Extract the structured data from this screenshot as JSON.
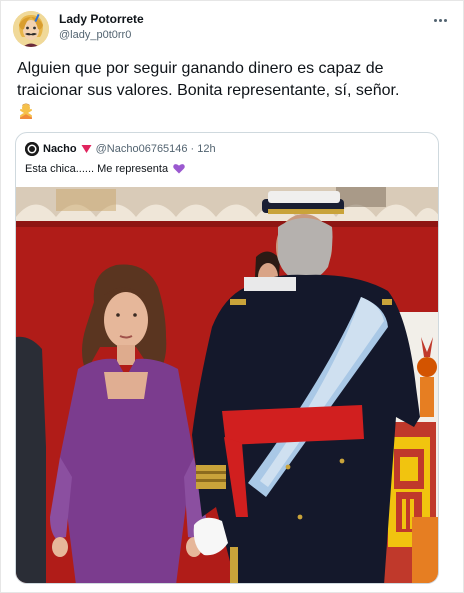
{
  "tweet": {
    "author_name": "Lady Potorrete",
    "author_handle": "@lady_p0t0rr0",
    "text": "Alguien que por seguir ganando dinero es capaz de traicionar sus valores. Bonita representante, sí, señor.",
    "trailing_emoji": "person-gesturing-no-emoji",
    "more_icon": "more-horizontal-icon"
  },
  "quote": {
    "author_name": "Nacho",
    "badge_icon": "heart-icon",
    "badge_color": "#e0245e",
    "author_handle": "@Nacho06765146",
    "separator": "·",
    "time": "12h",
    "text": "Esta chica...... Me representa",
    "trailing_emoji": "purple-heart-emoji",
    "emoji_color": "#9b59d0"
  },
  "photo": {
    "description_icon": "photo-image",
    "dress_color": "#7b3c8e",
    "backdrop_color": "#b01c18",
    "sash_color": "#a9c8e6"
  }
}
